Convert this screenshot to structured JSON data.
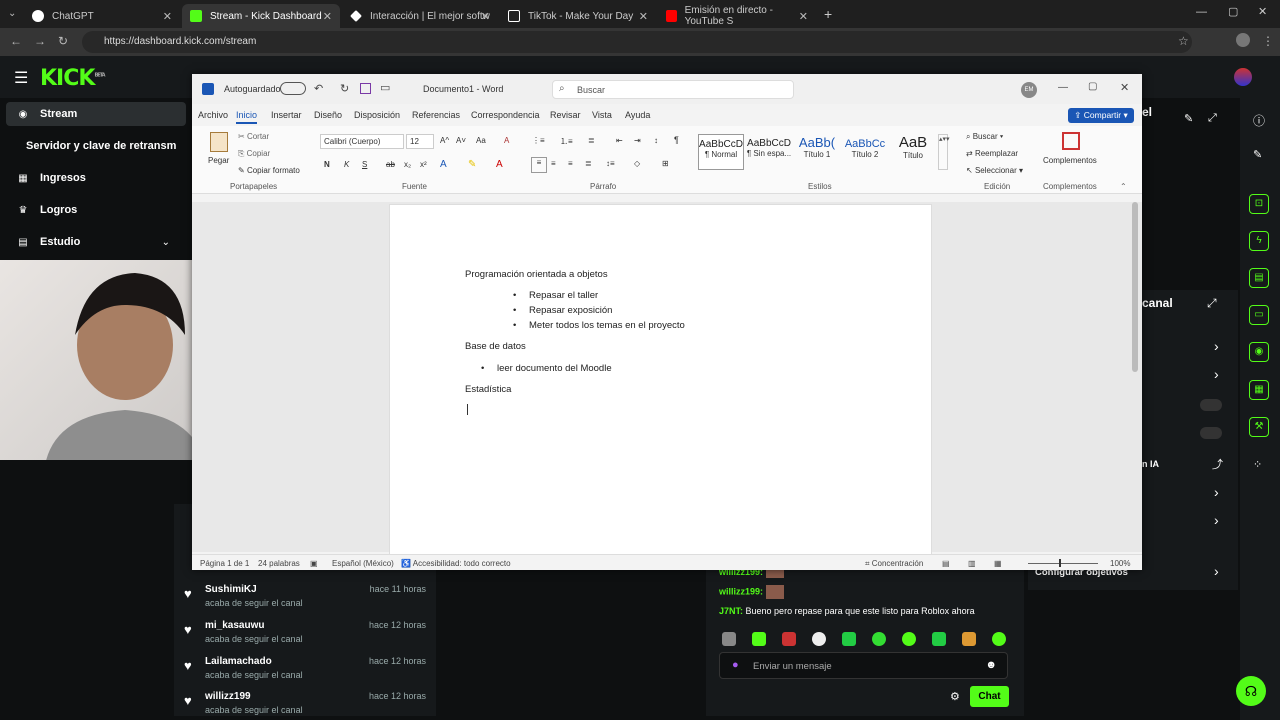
{
  "browser": {
    "tabs": [
      {
        "title": "ChatGPT",
        "active": false,
        "color": "#ffffff"
      },
      {
        "title": "Stream - Kick Dashboard",
        "active": true,
        "color": "#53fc18"
      },
      {
        "title": "Interacción | El mejor softw",
        "active": false,
        "color": "#ffffff"
      },
      {
        "title": "TikTok - Make Your Day",
        "active": false,
        "color": "#ffffff"
      },
      {
        "title": "Emisión en directo - YouTube S",
        "active": false,
        "color": "#ff0000"
      }
    ],
    "url": "https://dashboard.kick.com/stream"
  },
  "kick": {
    "logo": "KICK",
    "logo_badge": "BETA",
    "accent": "#53fc18",
    "sidebar": [
      {
        "label": "Stream",
        "icon": "broadcast-icon",
        "active": true
      },
      {
        "label": "Servidor y clave de retransm",
        "icon": "",
        "active": false
      },
      {
        "label": "Ingresos",
        "icon": "chart-icon",
        "active": false
      },
      {
        "label": "Logros",
        "icon": "trophy-icon",
        "active": false
      },
      {
        "label": "Estudio",
        "icon": "studio-icon",
        "active": false
      }
    ],
    "followers": [
      {
        "name": "SushimiKJ",
        "sub": "acaba de seguir el canal",
        "time": "hace 11 horas"
      },
      {
        "name": "mi_kasauwu",
        "sub": "acaba de seguir el canal",
        "time": "hace 12 horas"
      },
      {
        "name": "Lailamachado",
        "sub": "acaba de seguir el canal",
        "time": "hace 12 horas"
      },
      {
        "name": "willizz199",
        "sub": "acaba de seguir el canal",
        "time": "hace 12 horas"
      }
    ],
    "chat": {
      "messages": [
        {
          "user": "willizz199:",
          "text": ""
        },
        {
          "user": "willizz199:",
          "text": ""
        },
        {
          "user": "J7NT:",
          "text": "Bueno pero repase para que este listo para Roblox ahora"
        }
      ],
      "placeholder": "Enviar un mensaje",
      "send_label": "Chat"
    },
    "right_panel": {
      "title_fragment": "canal",
      "title_fragment_top": "el",
      "ia_label": "n IA",
      "configure_goals": "Configurar objetivos"
    }
  },
  "word": {
    "autosave_label": "Autoguardado",
    "doc_title": "Documento1 - Word",
    "search_placeholder": "Buscar",
    "avatar_initials": "EM",
    "share_label": "Compartir",
    "tabs": [
      "Archivo",
      "Inicio",
      "Insertar",
      "Diseño",
      "Disposición",
      "Referencias",
      "Correspondencia",
      "Revisar",
      "Vista",
      "Ayuda"
    ],
    "active_tab": "Inicio",
    "ribbon": {
      "clipboard": {
        "paste": "Pegar",
        "cut": "Cortar",
        "copy": "Copiar",
        "format_painter": "Copiar formato",
        "label": "Portapapeles"
      },
      "font": {
        "family": "Calibri (Cuerpo)",
        "size": "12",
        "label": "Fuente"
      },
      "paragraph": {
        "label": "Párrafo"
      },
      "styles": {
        "items": [
          {
            "sample": "AaBbCcD",
            "name": "¶ Normal"
          },
          {
            "sample": "AaBbCcD",
            "name": "¶ Sin espa..."
          },
          {
            "sample": "AaBb(",
            "name": "Título 1"
          },
          {
            "sample": "AaBbCc",
            "name": "Título 2"
          },
          {
            "sample": "AaB",
            "name": "Título"
          }
        ],
        "label": "Estilos"
      },
      "editing": {
        "find": "Buscar",
        "replace": "Reemplazar",
        "select": "Seleccionar",
        "label": "Edición"
      },
      "addins": {
        "button": "Complementos",
        "label": "Complementos"
      }
    },
    "document": {
      "heading1": "Programación orientada a objetos",
      "list1": [
        "Repasar el taller",
        "Repasar exposición",
        "Meter todos los temas en el proyecto"
      ],
      "heading2": "Base de datos",
      "list2": [
        "leer documento del Moodle"
      ],
      "heading3": "Estadística"
    },
    "status": {
      "page": "Página 1 de 1",
      "words": "24 palabras",
      "language": "Español (México)",
      "accessibility": "Accesibilidad: todo correcto",
      "focus": "Concentración",
      "zoom": "100%"
    }
  }
}
